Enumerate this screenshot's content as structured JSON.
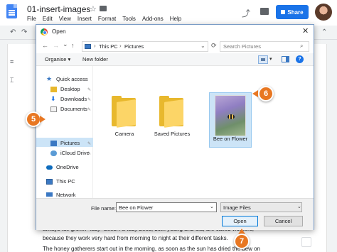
{
  "docs": {
    "title": "01-insert-images",
    "star": "☆",
    "menu": [
      "File",
      "Edit",
      "View",
      "Insert",
      "Format",
      "Tools",
      "Add-ons",
      "Help"
    ],
    "trend_icon": "⤴",
    "share_label": "Share",
    "doc_lines": [
      "always full-grown \"lady\" bees. All lady bees, both young and old, are called workers,",
      "because they work very hard from morning to night at their different tasks.",
      "The honey gatherers start out in the morning, as soon as the sun has dried the dew on"
    ]
  },
  "dialog": {
    "title": "Open",
    "close": "✕",
    "nav": {
      "back": "←",
      "forward": "→",
      "down": "⌄",
      "up": "↑"
    },
    "breadcrumb": [
      "This PC",
      "Pictures"
    ],
    "refresh": "⟳",
    "search_placeholder": "Search Pictures",
    "search_icon": "⌕",
    "organise_label": "Organise ▾",
    "new_folder_label": "New folder",
    "help": "?",
    "sidebar": [
      {
        "label": "Quick access",
        "icon": "star-icon",
        "color": "#3a78c3",
        "pinned": false
      },
      {
        "label": "Desktop",
        "icon": "desktop-icon",
        "color": "#3a78c3",
        "pinned": true
      },
      {
        "label": "Downloads",
        "icon": "download-icon",
        "color": "#1a73e8",
        "pinned": true
      },
      {
        "label": "Documents",
        "icon": "documents-icon",
        "color": "#8a8a8a",
        "pinned": true
      },
      {
        "label": "Pictures",
        "icon": "pictures-icon",
        "color": "#3a78c3",
        "pinned": true,
        "selected": true
      },
      {
        "label": "iCloud Drive",
        "icon": "cloud-icon",
        "color": "#5a9bd5",
        "pinned": true
      },
      {
        "label": "OneDrive",
        "icon": "onedrive-icon",
        "color": "#0f6cbd",
        "pinned": false
      },
      {
        "label": "This PC",
        "icon": "pc-icon",
        "color": "#3a78c3",
        "pinned": false
      },
      {
        "label": "Network",
        "icon": "network-icon",
        "color": "#3a78c3",
        "pinned": false
      }
    ],
    "files": [
      {
        "label": "Camera",
        "type": "folder"
      },
      {
        "label": "Saved Pictures",
        "type": "folder"
      },
      {
        "label": "Bee on Flower",
        "type": "image",
        "selected": true
      }
    ],
    "filename_label": "File name:",
    "filename_value": "Bee on Flower",
    "filetype_value": "Image Files",
    "open_label": "Open",
    "cancel_label": "Cancel"
  },
  "steps": [
    "5",
    "6",
    "7"
  ],
  "colors": {
    "accent": "#1a73e8",
    "callout": "#e87722",
    "selection": "#cce4f7"
  }
}
